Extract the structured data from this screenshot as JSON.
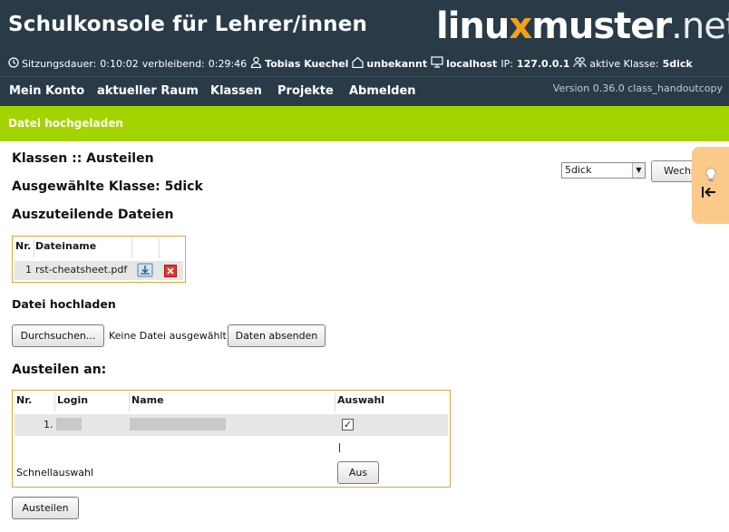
{
  "header": {
    "title": "Schulkonsole für Lehrer/innen",
    "logo": {
      "part1": "linu",
      "x": "x",
      "part2": "muster",
      "part3": ".net"
    }
  },
  "status": {
    "session_label": "Sitzungsdauer:",
    "session_value": "0:10:02",
    "remaining_label": "verbleibend:",
    "remaining_value": "0:29:46",
    "user": "Tobias Kuechel",
    "room": "unbekannt",
    "host": "localhost",
    "ip_label": "IP:",
    "ip": "127.0.0.1",
    "class_label": "aktive Klasse:",
    "class": "5dick"
  },
  "nav": {
    "items": [
      "Mein Konto",
      "aktueller Raum",
      "Klassen",
      "Projekte",
      "Abmelden"
    ],
    "version": "Version 0.36.0 class_handoutcopy"
  },
  "notice": "Datei hochgeladen",
  "main": {
    "heading": "Klassen :: Austeilen",
    "selected_class": "Ausgewählte Klasse: 5dick",
    "files_heading": "Auszuteilende Dateien",
    "class_select_value": "5dick",
    "switch_button": "Wechseln",
    "files_table": {
      "headers": [
        "Nr.",
        "Dateiname"
      ],
      "rows": [
        {
          "nr": "1",
          "name": "rst-cheatsheet.pdf"
        }
      ]
    },
    "upload_heading": "Datei hochladen",
    "browse_button": "Durchsuchen...",
    "no_file": "Keine Datei ausgewählt.",
    "submit_button": "Daten absenden",
    "distribute_heading": "Austeilen an:",
    "users_table": {
      "headers": [
        "Nr.",
        "Login",
        "Name",
        "Auswahl"
      ],
      "rows": [
        {
          "nr": "1.",
          "checked": true
        }
      ],
      "quick_select_label": "Schnellauswahl",
      "quick_select_button": "Aus"
    },
    "distribute_button": "Austeilen"
  },
  "colors": {
    "header_bg": "#2a3b48",
    "notice_bg": "#a3d400",
    "table_border": "#e5a43a",
    "side_tab": "#fbc98a",
    "logo_accent": "#f0a21c"
  }
}
